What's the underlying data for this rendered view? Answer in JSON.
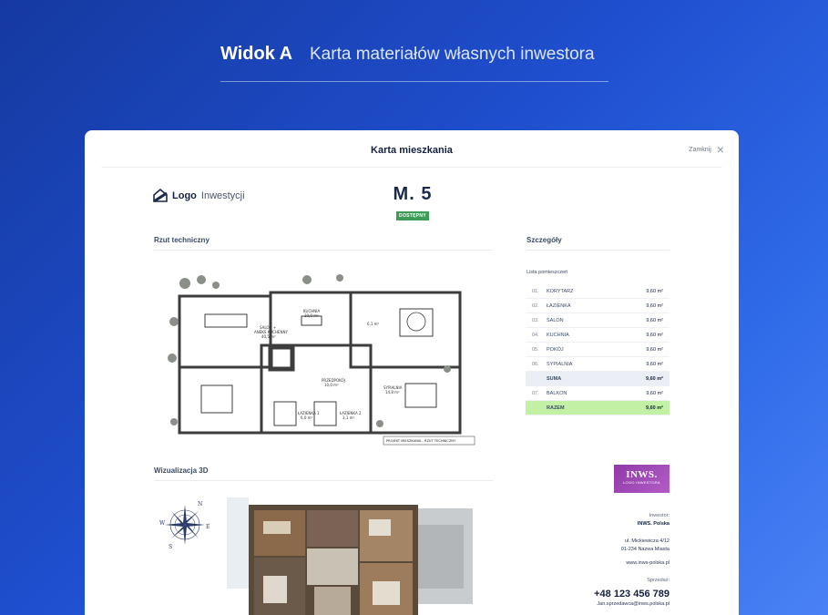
{
  "hero": {
    "view_label": "Widok A",
    "subtitle": "Karta materiałów własnych inwestora"
  },
  "modal": {
    "title": "Karta mieszkania",
    "close_label": "Zamknij"
  },
  "brand": {
    "logo_bold": "Logo",
    "logo_light": "Inwestycji"
  },
  "unit": {
    "number": "M. 5",
    "status": "DOSTĘPNY",
    "status_color": "#3f9b58"
  },
  "sections": {
    "plan_title": "Rzut techniczny",
    "details_title": "Szczegóły",
    "viz_title": "Wizualizacja 3D"
  },
  "plan": {
    "labels": {
      "salon": "SALON +",
      "aneks": "ANEKS KUCHENNY",
      "salon_area": "40,5 m²",
      "kuchnia": "KUCHNIA",
      "kuchnia_area": "10,0 m²",
      "przedpokoj": "PRZEDPOKÓJ",
      "przedpokoj_area": "10,0 m²",
      "lazienka1": "ŁAZIENKA 1",
      "lazienka1_area": "6,0 m²",
      "lazienka2": "ŁAZIENKA 2",
      "lazienka2_area": "3,1 m²",
      "sypialnia": "SYPIALNIA",
      "sypialnia_area": "14,8 m²",
      "small_area": "6,1 m²",
      "footer": "PROJEKT MIESZKANIA - RZUT TECHNICZNY"
    }
  },
  "rooms": {
    "list_title": "Lista pomieszczeń",
    "items": [
      {
        "no": "01.",
        "name": "KORYTARZ",
        "area": "9,60 m²"
      },
      {
        "no": "02.",
        "name": "ŁAZIENKA",
        "area": "9,60 m²"
      },
      {
        "no": "03.",
        "name": "SALON",
        "area": "9,60 m²"
      },
      {
        "no": "04.",
        "name": "KUCHNIA",
        "area": "9,60 m²"
      },
      {
        "no": "05.",
        "name": "POKÓJ",
        "area": "9,60 m²"
      },
      {
        "no": "06.",
        "name": "SYPIALNIA",
        "area": "9,60 m²"
      }
    ],
    "suma": {
      "name": "SUMA",
      "area": "9,60 m²"
    },
    "balcony": {
      "no": "07.",
      "name": "BALKON",
      "area": "9,60 m²"
    },
    "razem": {
      "name": "RAZEM",
      "area": "9,60 m²"
    }
  },
  "investor": {
    "logo_big": "INWS.",
    "logo_small": "LOGO INWESTORA",
    "label": "Inwestor:",
    "name": "INWS. Polska",
    "address1": "ul. Mickiewicza 4/12",
    "address2": "01-234 Nazwa Miasta",
    "website": "www.inws-polska.pl",
    "sales_label": "Sprzedaż:",
    "phone": "+48 123 456 789",
    "email": "Jan.sprzedawca@inws.polska.pl"
  },
  "compass": {
    "letters": [
      "N",
      "E",
      "S",
      "W"
    ]
  }
}
